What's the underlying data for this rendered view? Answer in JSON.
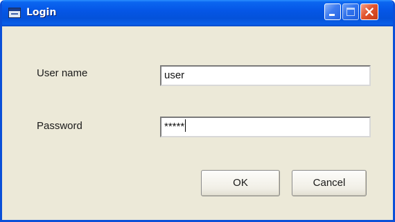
{
  "window": {
    "title": "Login",
    "app_icon": "window-app-icon",
    "controls": {
      "minimize_icon": "minimize-icon",
      "maximize_icon": "maximize-icon",
      "close_icon": "close-icon"
    },
    "colors": {
      "titlebar": "#0556e6",
      "client_background": "#ece9d8",
      "close_button": "#e2552f"
    }
  },
  "form": {
    "username_label": "User name",
    "username_value": "user",
    "password_label": "Password",
    "password_value": "*****"
  },
  "buttons": {
    "ok_label": "OK",
    "cancel_label": "Cancel"
  }
}
